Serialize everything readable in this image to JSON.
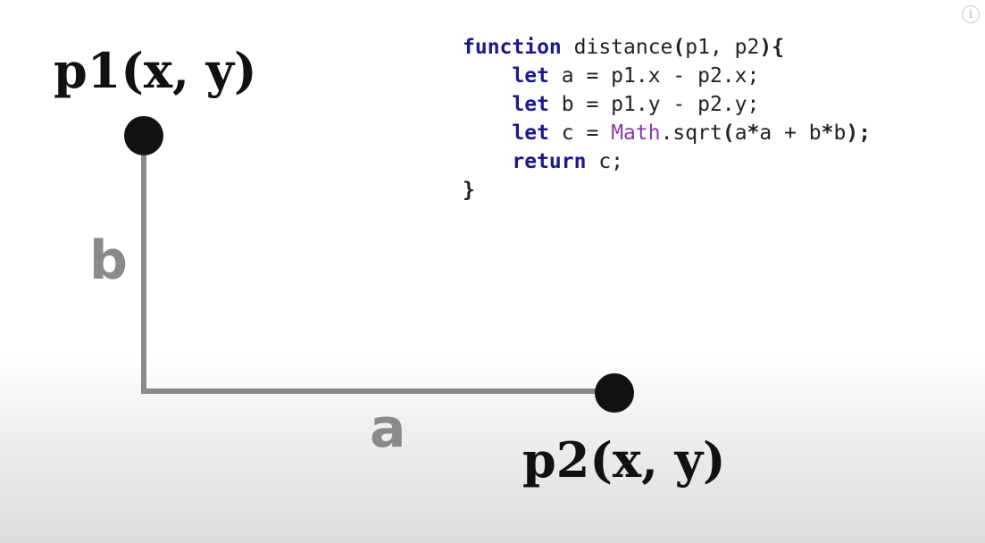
{
  "points": {
    "p1_label": "p1(x, y)",
    "p2_label": "p2(x, y)"
  },
  "sides": {
    "vertical_label": "b",
    "horizontal_label": "a"
  },
  "code": {
    "line1": {
      "kw": "function",
      "rest": " distance",
      "open": "(",
      "params": "p1, p2",
      "close": "){"
    },
    "line2": {
      "kw": "let",
      "rest": " a = p1.x - p2.x;"
    },
    "line3": {
      "kw": "let",
      "rest": " b = p1.y - p2.y;"
    },
    "line4": {
      "kw": "let",
      "mid": " c = ",
      "cls": "Math",
      "call": ".sqrt",
      "args_open": "(",
      "expr1": "a",
      "star1": "*",
      "expr2": "a + b",
      "star2": "*",
      "expr3": "b",
      "args_close": ");"
    },
    "line5": {
      "kw": "return",
      "rest": " c;"
    },
    "line6": {
      "rest": "}"
    }
  },
  "colors": {
    "keyword": "#1a1a8c",
    "class_name": "#8b3aa8",
    "line_gray": "#8a8a8a",
    "dot": "#111111"
  },
  "info_icon": "info-icon"
}
